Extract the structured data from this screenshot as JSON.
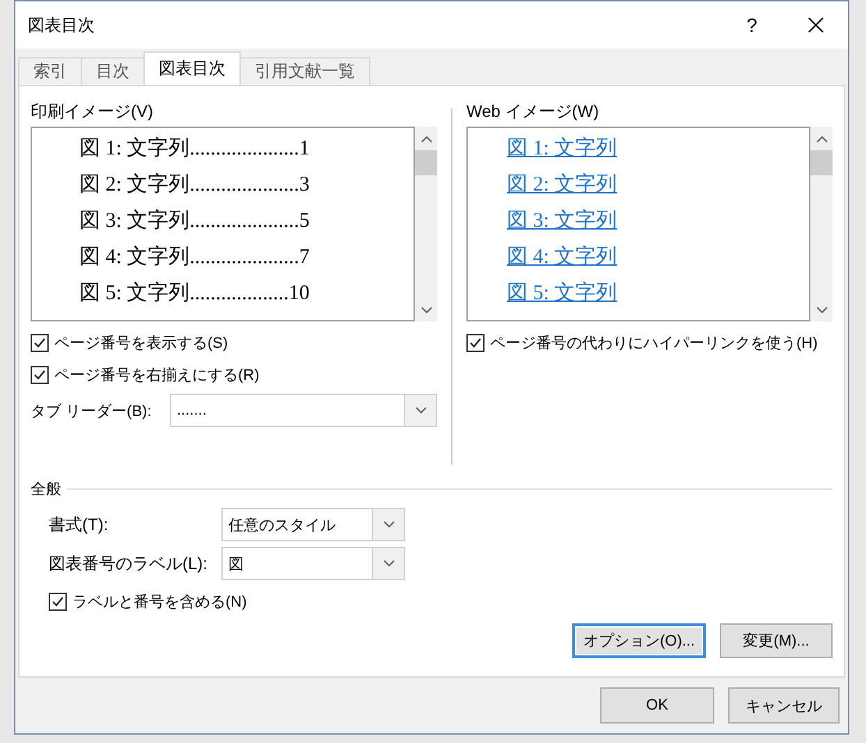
{
  "window": {
    "title": "図表目次",
    "help": "?"
  },
  "tabs": [
    {
      "label": "索引",
      "selected": false
    },
    {
      "label": "目次",
      "selected": false
    },
    {
      "label": "図表目次",
      "selected": true
    },
    {
      "label": "引用文献一覧",
      "selected": false
    }
  ],
  "print_preview": {
    "label": "印刷イメージ(V)",
    "entries": [
      "図 1: 文字列.....................1",
      "図 2: 文字列.....................3",
      "図 3: 文字列.....................5",
      "図 4: 文字列.....................7",
      "図 5: 文字列...................10"
    ]
  },
  "print_options": [
    {
      "label": "ページ番号を表示する(S)",
      "checked": true
    },
    {
      "label": "ページ番号を右揃えにする(R)",
      "checked": true
    }
  ],
  "tab_leader": {
    "label": "タブ リーダー(B):",
    "value": "......."
  },
  "web_preview": {
    "label": "Web イメージ(W)",
    "entries": [
      "図 1: 文字列",
      "図 2: 文字列",
      "図 3: 文字列",
      "図 4: 文字列",
      "図 5: 文字列"
    ]
  },
  "web_options": [
    {
      "label": "ページ番号の代わりにハイパーリンクを使う(H)",
      "checked": true
    }
  ],
  "general": {
    "title": "全般",
    "fields": [
      {
        "label": "書式(T):",
        "value": "任意のスタイル"
      },
      {
        "label": "図表番号のラベル(L):",
        "value": "図"
      }
    ],
    "options": [
      {
        "label": "ラベルと番号を含める(N)",
        "checked": true
      }
    ]
  },
  "panel_buttons": [
    {
      "label": "オプション(O)...",
      "focused": true
    },
    {
      "label": "変更(M)...",
      "focused": false
    }
  ],
  "buttons": [
    "OK",
    "キャンセル"
  ]
}
